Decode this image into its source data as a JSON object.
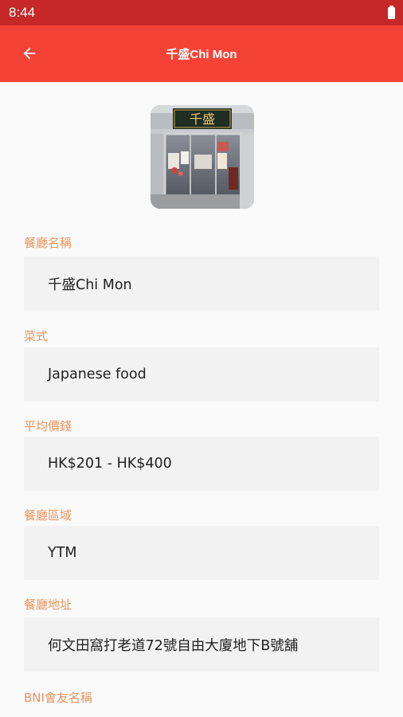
{
  "status_bar": {
    "time": "8:44"
  },
  "app_bar": {
    "title": "千盛Chi Mon"
  },
  "fields": [
    {
      "label": "餐廳名稱",
      "value": "千盛Chi Mon"
    },
    {
      "label": "菜式",
      "value": "Japanese food"
    },
    {
      "label": "平均價錢",
      "value": "HK$201 - HK$400"
    },
    {
      "label": "餐廳區域",
      "value": "YTM"
    },
    {
      "label": "餐廳地址",
      "value": "何文田窩打老道72號自由大廈地下B號舖"
    },
    {
      "label": "BNI會友名稱",
      "value": ""
    }
  ],
  "colors": {
    "status_bar": "#c62828",
    "app_bar": "#f44336",
    "label": "#e8955e",
    "field_bg": "#f2f2f2"
  },
  "icons": {
    "back": "arrow-left-icon",
    "battery": "battery-icon"
  },
  "photo": {
    "signboard_text": "千盛"
  }
}
